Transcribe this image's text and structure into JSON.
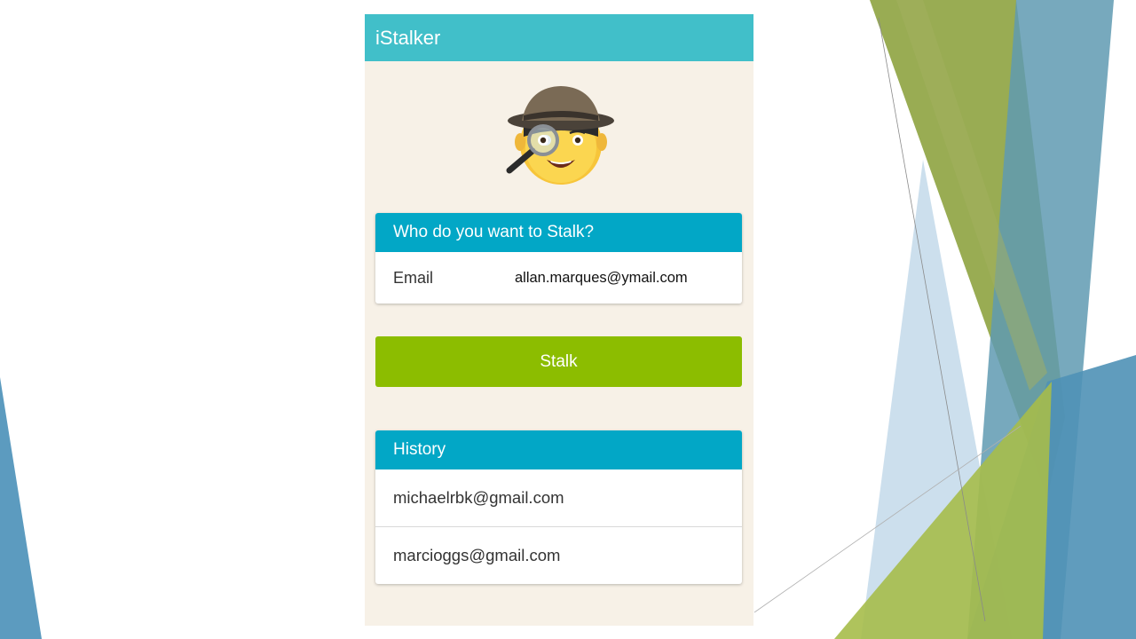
{
  "app": {
    "title": "iStalker",
    "mascot_icon": "detective-icon"
  },
  "search_card": {
    "header": "Who do you want to Stalk?",
    "email_label": "Email",
    "email_value": "allan.marques@ymail.com"
  },
  "stalk_button": {
    "label": "Stalk"
  },
  "history": {
    "header": "History",
    "items": [
      "michaelrbk@gmail.com",
      "marcioggs@gmail.com"
    ]
  },
  "colors": {
    "app_bar": "#41bfc9",
    "card_header": "#02a7c6",
    "button": "#8cbd00",
    "background": "#f7f1e7"
  }
}
